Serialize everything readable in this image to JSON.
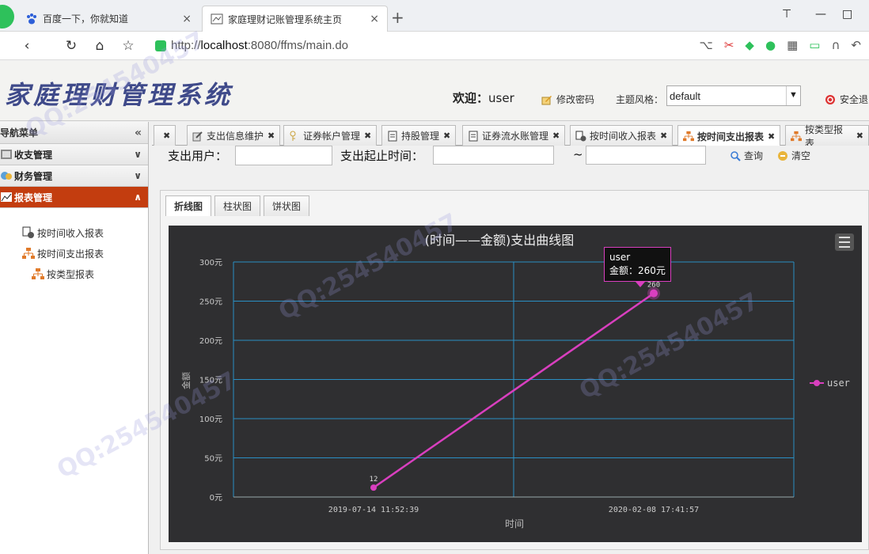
{
  "browser": {
    "tabs": [
      {
        "title": "百度一下，你就知道",
        "active": false
      },
      {
        "title": "家庭理财记账管理系统主页",
        "active": true
      }
    ],
    "close_glyph": "×",
    "new_tab_glyph": "+",
    "address": {
      "host": "localhost",
      "rest": ":8080/ffms/main.do",
      "scheme": "http://"
    },
    "window_controls": {
      "shirt": "⊤",
      "minimize": "—",
      "maximize": "□"
    }
  },
  "app": {
    "title": "家庭理财管理系统",
    "welcome_label": "欢迎：",
    "username": "user",
    "change_password": "修改密码",
    "theme_label": "主题风格：",
    "theme_value": "default",
    "logout": "安全退"
  },
  "sidebar": {
    "header": "导航菜单",
    "groups": [
      {
        "label": "收支管理",
        "active": false
      },
      {
        "label": "财务管理",
        "active": false
      },
      {
        "label": "报表管理",
        "active": true
      }
    ],
    "items": [
      {
        "label": "按时间收入报表"
      },
      {
        "label": "按时间支出报表"
      },
      {
        "label": "按类型报表"
      }
    ]
  },
  "content_tabs": [
    {
      "label": "",
      "active": false
    },
    {
      "label": "支出信息维护",
      "active": false
    },
    {
      "label": "证券帐户管理",
      "active": false
    },
    {
      "label": "持股管理",
      "active": false
    },
    {
      "label": "证券流水账管理",
      "active": false
    },
    {
      "label": "按时间收入报表",
      "active": false
    },
    {
      "label": "按时间支出报表",
      "active": true
    },
    {
      "label": "按类型报表",
      "active": false
    }
  ],
  "search": {
    "user_label": "支出用户：",
    "time_label": "支出起止时间：",
    "tilde": "~",
    "query_button": "查询",
    "clear_button": "清空"
  },
  "chart_tabs": [
    {
      "label": "折线图",
      "active": true
    },
    {
      "label": "柱状图",
      "active": false
    },
    {
      "label": "饼状图",
      "active": false
    }
  ],
  "chart_data": {
    "type": "line",
    "title": "(时间——金额)支出曲线图",
    "xlabel": "时间",
    "ylabel": "金额",
    "x": [
      "2019-07-14 11:52:39",
      "2020-02-08 17:41:57"
    ],
    "series": [
      {
        "name": "user",
        "values": [
          12,
          260
        ],
        "color": "#d93fbf"
      }
    ],
    "ylim": [
      0,
      300
    ],
    "yticks": [
      "0元",
      "50元",
      "100元",
      "150元",
      "200元",
      "250元",
      "300元"
    ],
    "grid": true,
    "legend": "right",
    "tooltip": {
      "series": "user",
      "text": "金额：260元"
    }
  }
}
